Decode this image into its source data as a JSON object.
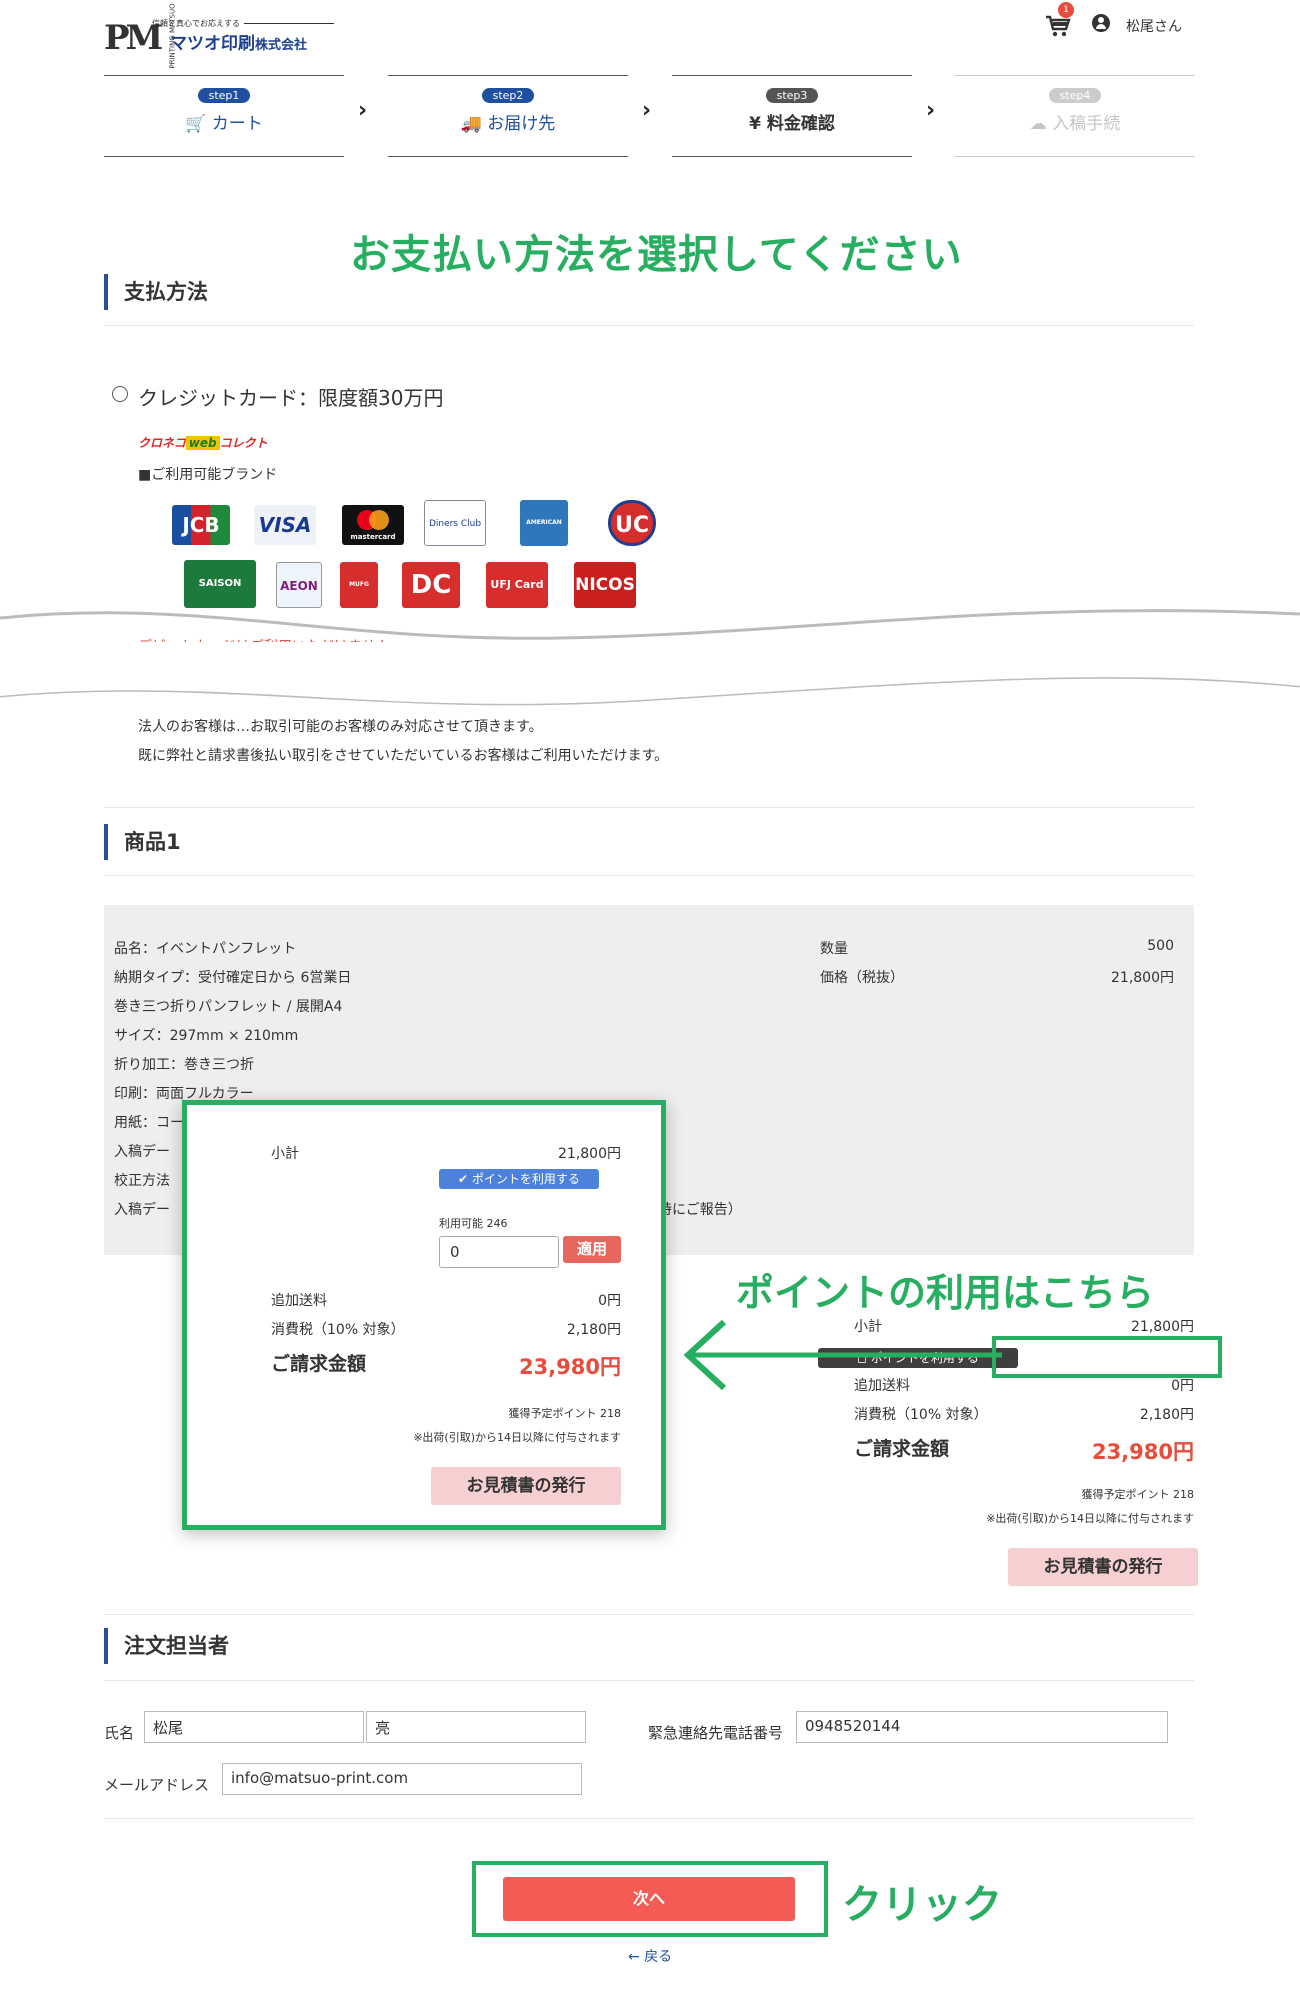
{
  "header": {
    "logo_tagline": "信頼と真心でお応えする",
    "logo_name": "マツオ印刷",
    "logo_suffix": "株式会社",
    "logo_side": "PRINTING MATSUO",
    "cart_count": "1",
    "user_name": "松尾さん"
  },
  "steps": [
    {
      "badge": "step1",
      "label": "カート",
      "icon": "cart-icon"
    },
    {
      "badge": "step2",
      "label": "お届け先",
      "icon": "truck-icon"
    },
    {
      "badge": "step3",
      "label": "¥ 料金確認",
      "icon": "yen-icon"
    },
    {
      "badge": "step4",
      "label": "入稿手続",
      "icon": "cloud-upload-icon"
    }
  ],
  "annotations": {
    "title": "お支払い方法を選択してください",
    "point": "ポイントの利用はこちら",
    "click": "クリック"
  },
  "payment": {
    "heading": "支払方法",
    "option_label": "クレジットカード：限度額30万円",
    "provider": "クロネコwebコレクト",
    "provider_prefix": "クロネコ",
    "provider_web": "web",
    "provider_suffix": "コレクト",
    "brands_label": "■ご利用可能ブランド",
    "brands": [
      "JCB",
      "VISA",
      "mastercard",
      "Diners Club",
      "AMERICAN EXPRESS",
      "UC",
      "SAISON CARD",
      "AEON",
      "MUFG CARD",
      "DC",
      "UFJ Card",
      "NICOS"
    ],
    "warning": "デビットカードはご利用いただけません。",
    "invoice_note1": "法人のお客様は…お取引可能のお客様のみ対応させて頂きます。",
    "invoice_note2": "既に弊社と請求書後払い取引をさせていただいているお客様はご利用いただけます。"
  },
  "product": {
    "heading": "商品1",
    "details": [
      "品名：イベントパンフレット",
      "納期タイプ：受付確定日から 6営業日",
      "巻き三つ折りパンフレット / 展開A4",
      "サイズ：297mm × 210mm",
      "折り加工：巻き三つ折",
      "印刷：両面フルカラー",
      "用紙：コー",
      "入稿デー",
      "校正方法",
      "入稿デー"
    ],
    "detail_tail": "時にご報告）",
    "qty_label": "数量",
    "qty_value": "500",
    "price_label": "価格（税抜）",
    "price_value": "21,800円"
  },
  "summary": {
    "subtotal_label": "小計",
    "subtotal_value": "21,800円",
    "use_points_label": "ポイントを利用する",
    "points_available": "利用可能 246",
    "points_input": "0",
    "apply_label": "適用",
    "shipping_label": "追加送料",
    "shipping_value": "0円",
    "tax_label": "消費税（10% 対象）",
    "tax_value": "2,180円",
    "total_label": "ご請求金額",
    "total_value": "23,980円",
    "earned_points": "獲得予定ポイント 218",
    "earned_note": "※出荷(引取)から14日以降に付与されます",
    "quote_button": "お見積書の発行"
  },
  "orderer": {
    "heading": "注文担当者",
    "name_label": "氏名",
    "last_name": "松尾",
    "first_name": "亮",
    "phone_label": "緊急連絡先電話番号",
    "phone_value": "0948520144",
    "email_label": "メールアドレス",
    "email_value": "info@matsuo-print.com"
  },
  "footer": {
    "next_button": "次へ",
    "back_link": "戻る"
  },
  "colors": {
    "accent_green": "#27ae60",
    "brand_blue": "#1f4f9f",
    "price_red": "#e74c3c",
    "next_button": "#f25c54"
  }
}
